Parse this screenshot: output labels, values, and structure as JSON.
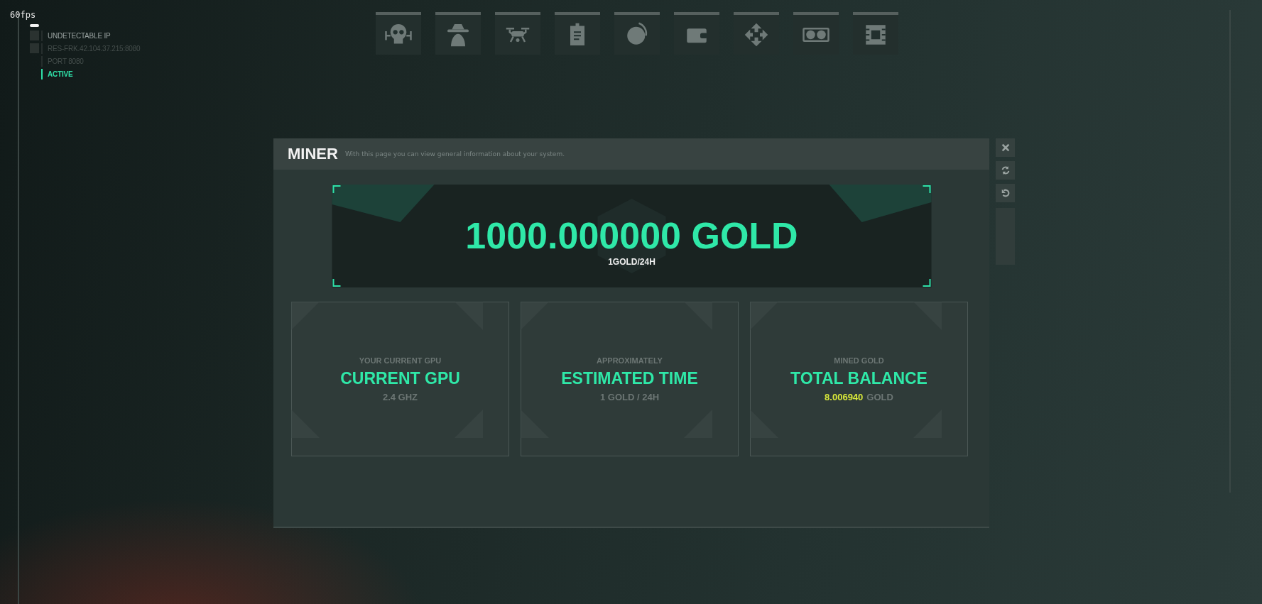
{
  "fps": "60fps",
  "status": [
    {
      "label": "UNDETECTABLE IP",
      "kind": "square",
      "active": false,
      "bright": true
    },
    {
      "label": "RES-FRK.42.104.37.215:8080",
      "kind": "square",
      "active": false,
      "bright": false
    },
    {
      "label": "PORT 8080",
      "kind": "plain",
      "active": false,
      "bright": false
    },
    {
      "label": "ACTIVE",
      "kind": "plain",
      "active": true,
      "bright": true
    }
  ],
  "window": {
    "title": "MINER",
    "subtitle": "With this page you can view general information about your system."
  },
  "banner": {
    "amount": "1000.000000 GOLD",
    "rate": "1GOLD/24H"
  },
  "cards": [
    {
      "caption": "YOUR CURRENT GPU",
      "title": "CURRENT GPU",
      "value": "2.4 GHZ",
      "kind": "plain"
    },
    {
      "caption": "APPROXIMATELY",
      "title": "ESTIMATED TIME",
      "value": "1 GOLD / 24H",
      "kind": "plain"
    },
    {
      "caption": "MINED GOLD",
      "title": "TOTAL BALANCE",
      "value": "8.006940",
      "unit": "GOLD",
      "kind": "balance"
    }
  ]
}
